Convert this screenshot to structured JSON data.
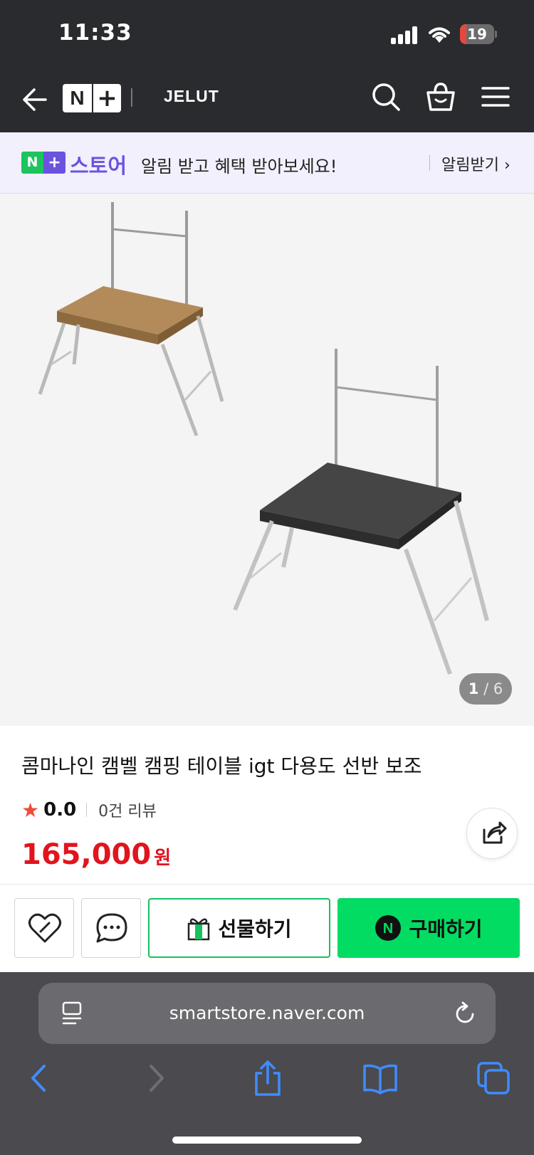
{
  "status_bar": {
    "time": "11:33",
    "battery": "19",
    "battery_level": 0.19
  },
  "nav": {
    "logo_n": "N",
    "logo_plus": "+",
    "brand": "JELUT"
  },
  "notice": {
    "badge_n": "N",
    "badge_plus": "+",
    "store_label": "스토어",
    "message": "알림 받고 혜택 받아보세요!",
    "action": "알림받기 ›"
  },
  "gallery": {
    "current": "1",
    "total": "6",
    "separator": "/"
  },
  "product": {
    "title": "콤마나인 캠벨 캠핑 테이블 igt 다용도 선반 보조",
    "rating": "0.0",
    "reviews": "0건 리뷰",
    "price": "165,000",
    "currency": "원"
  },
  "actions": {
    "gift": "선물하기",
    "buy": "구매하기",
    "buy_badge": "N"
  },
  "browser": {
    "url": "smartstore.naver.com"
  },
  "colors": {
    "brand_green": "#02dc62",
    "brand_purple": "#6b53e0",
    "price_red": "#e1141e",
    "safari_blue": "#3f8cff"
  },
  "icons": {
    "back": "back-arrow-icon",
    "search": "search-icon",
    "bag": "shopping-bag-icon",
    "menu": "hamburger-menu-icon",
    "share": "share-icon",
    "wishlist": "heart-icon",
    "chat": "chat-bubble-icon",
    "gift": "gift-icon"
  }
}
